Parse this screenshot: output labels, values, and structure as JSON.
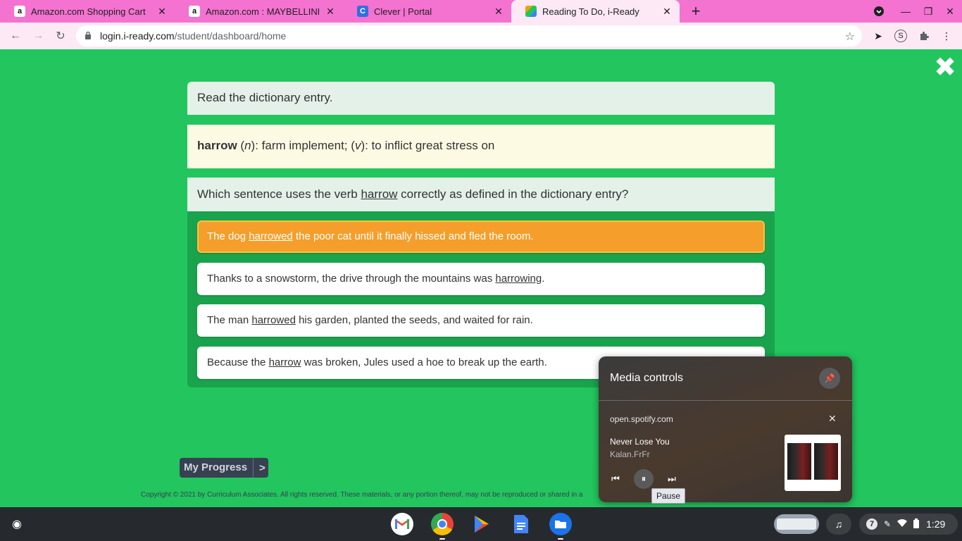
{
  "browser": {
    "tabs": [
      {
        "title": "Amazon.com Shopping Cart",
        "favicon": "a",
        "favicon_bg": "#ffffff",
        "favicon_color": "#111111"
      },
      {
        "title": "Amazon.com : MAYBELLINE Fit M",
        "favicon": "a",
        "favicon_bg": "#ffffff",
        "favicon_color": "#111111"
      },
      {
        "title": "Clever | Portal",
        "favicon": "C",
        "favicon_bg": "#2f6fe4",
        "favicon_color": "#ffffff"
      },
      {
        "title": "Reading To Do, i-Ready",
        "favicon": "",
        "favicon_bg": "#f59e0b",
        "favicon_color": "#ffffff"
      }
    ],
    "url_host": "login.i-ready.com",
    "url_path": "/student/dashboard/home",
    "extension_profile": "S"
  },
  "lesson": {
    "instruction": "Read the dictionary entry.",
    "entry": {
      "word": "harrow",
      "pos1": "n",
      "def1": ": farm implement; ",
      "pos2": "v",
      "def2": ": to inflict great stress on"
    },
    "question": {
      "before": "Which sentence uses the verb ",
      "word": "harrow",
      "after": " correctly as defined in the dictionary entry?"
    },
    "answers": [
      {
        "before": "The dog ",
        "word": "harrowed",
        "after": " the poor cat until it finally hissed and fled the room.",
        "selected": true
      },
      {
        "before": "Thanks to a snowstorm, the drive through the mountains was ",
        "word": "harrowing",
        "after": ".",
        "selected": false
      },
      {
        "before": "The man ",
        "word": "harrowed",
        "after": " his garden, planted the seeds, and waited for rain.",
        "selected": false
      },
      {
        "before": "Because the ",
        "word": "harrow",
        "after": " was broken, Jules used a hoe to break up the earth.",
        "selected": false
      }
    ],
    "progress_label": "My Progress",
    "progress_arrow": ">",
    "copyright": "Copyright © 2021 by Curriculum Associates. All rights reserved. These materials, or any portion thereof, may not be reproduced or shared in a"
  },
  "media_controls": {
    "title": "Media controls",
    "origin": "open.spotify.com",
    "track": "Never Lose You",
    "artist": "Kalan.FrFr",
    "tooltip": "Pause"
  },
  "shelf": {
    "notification_count": "7",
    "time": "1:29"
  }
}
